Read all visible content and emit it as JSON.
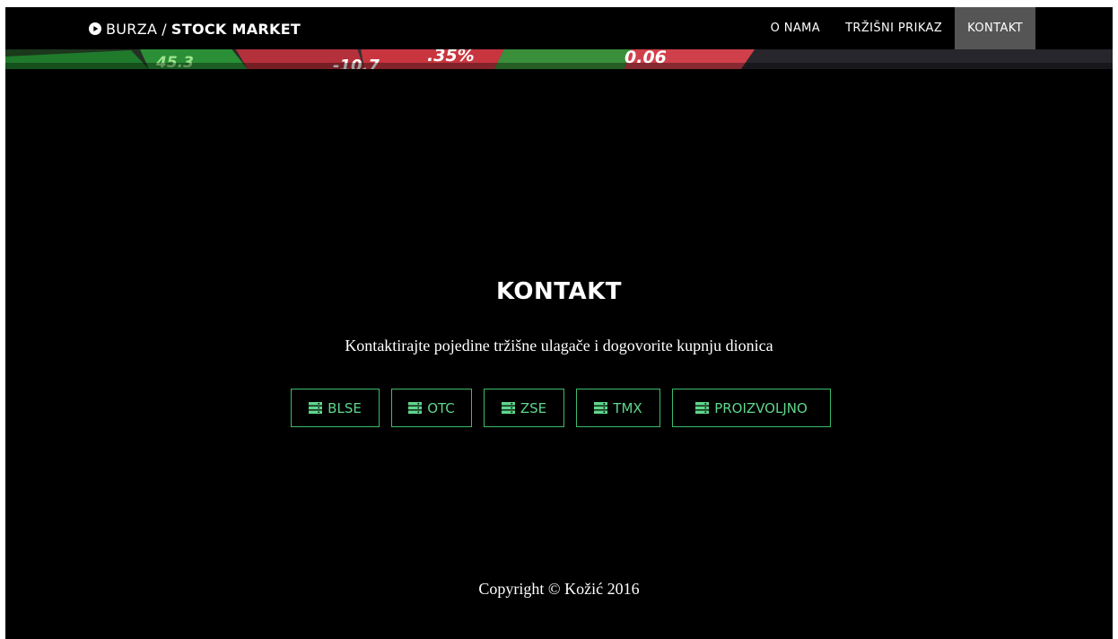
{
  "navbar": {
    "brand": {
      "icon": "play-circle-icon",
      "light_text": "BURZA",
      "separator": "/",
      "bold_text": "STOCK MARKET"
    },
    "items": [
      {
        "label": "O NAMA",
        "active": false
      },
      {
        "label": "TRŽIŠNI PRIKAZ",
        "active": false
      },
      {
        "label": "KONTAKT",
        "active": true
      }
    ]
  },
  "contact": {
    "title": "KONTAKT",
    "subtitle": "Kontaktirajte pojedine tržišne ulagače i dogovorite kupnju dionica",
    "buttons": [
      {
        "label": "BLSE",
        "icon": "server-icon"
      },
      {
        "label": "OTC",
        "icon": "server-icon"
      },
      {
        "label": "ZSE",
        "icon": "server-icon"
      },
      {
        "label": "TMX",
        "icon": "server-icon"
      },
      {
        "label": "PROIZVOLJNO",
        "icon": "server-icon"
      }
    ]
  },
  "footer": {
    "copyright": "Copyright © Kožić 2016"
  },
  "colors": {
    "background": "#000000",
    "accent": "#5fd68c",
    "active_nav": "#555555"
  }
}
